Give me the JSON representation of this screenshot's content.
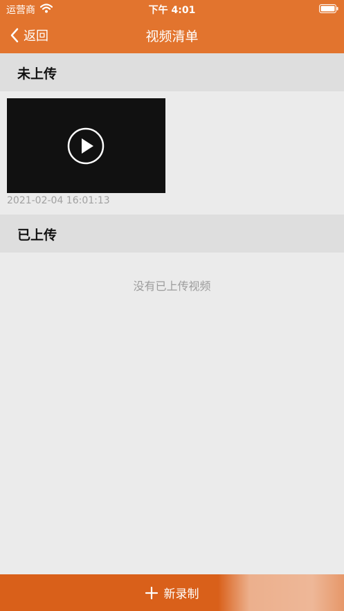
{
  "status_bar": {
    "carrier": "运营商",
    "time": "下午 4:01",
    "wifi_icon": "wifi-icon",
    "battery_icon": "battery-icon"
  },
  "nav": {
    "back_label": "返回",
    "back_icon": "chevron-left-icon",
    "title": "视频清单"
  },
  "sections": {
    "pending": {
      "title": "未上传",
      "videos": [
        {
          "timestamp": "2021-02-04 16:01:13",
          "icon": "play-icon"
        }
      ]
    },
    "uploaded": {
      "title": "已上传",
      "empty_text": "没有已上传视频"
    }
  },
  "bottom_bar": {
    "label": "新录制",
    "icon": "plus-icon"
  },
  "colors": {
    "header_bg": "#e2742e",
    "bottom_bar_bg": "#d9601a",
    "section_bg": "#dedede",
    "page_bg": "#ebebeb",
    "thumbnail_bg": "#111111"
  }
}
